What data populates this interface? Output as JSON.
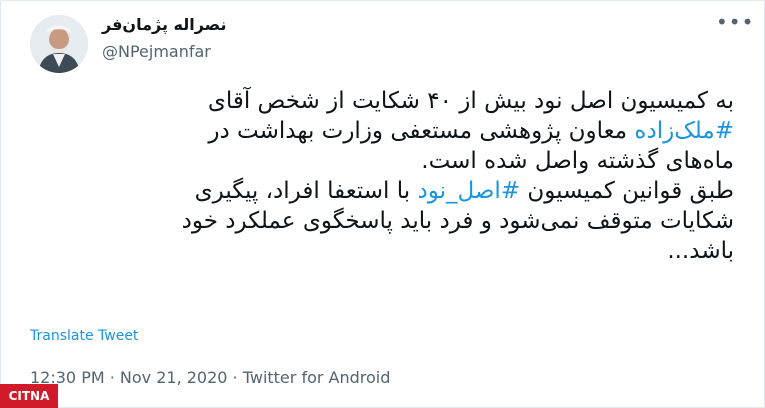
{
  "tweet": {
    "display_name": "نصراله پژمان‌فر",
    "handle": "@NPejmanfar",
    "more_icon": "more-icon",
    "body": {
      "line1": "به کمیسیون اصل نود بیش از ۴۰ شکایت از شخص آقای",
      "hashtag1": "#ملک‌زاده",
      "line2_rest": " معاون پژوهشی مستعفی وزارت بهداشت در",
      "line3": "ماه‌های گذشته واصل شده است.",
      "line4_pre": "طبق قوانین کمیسیون ",
      "hashtag2": "#اصل_نود",
      "line4_post": " با استعفا افراد، پیگیری",
      "line5": "شکایات متوقف نمی‌شود و فرد باید پاسخگوی عملکرد خود",
      "line6": "باشد..."
    },
    "translate_label": "Translate Tweet",
    "timestamp": "12:30 PM · Nov 21, 2020 · Twitter for Android"
  },
  "watermark": {
    "text": "CITNA"
  },
  "colors": {
    "accent": "#1b95e0",
    "muted": "#536471"
  }
}
